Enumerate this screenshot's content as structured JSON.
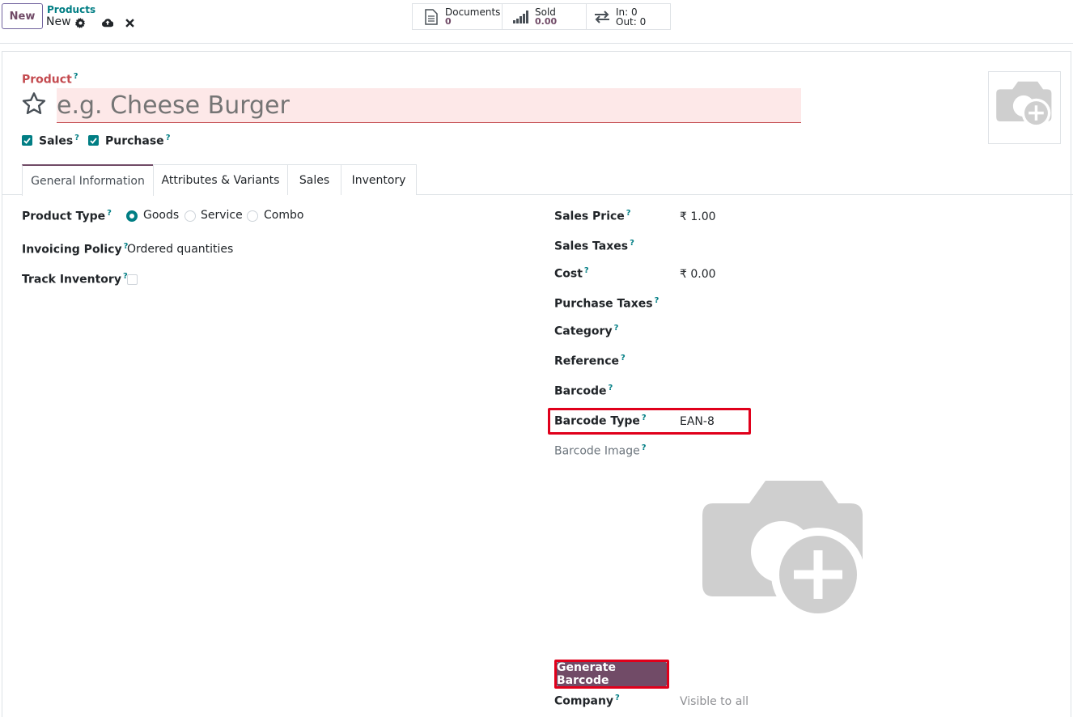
{
  "topbar": {
    "new_label": "New",
    "breadcrumb_parent": "Products",
    "breadcrumb_current": "New",
    "stats": {
      "documents_label": "Documents",
      "documents_value": "0",
      "sold_label": "Sold",
      "sold_value": "0.00",
      "in_label": "In: 0",
      "out_label": "Out: 0"
    }
  },
  "header": {
    "product_label": "Product",
    "name_placeholder": "e.g. Cheese Burger",
    "sales_label": "Sales",
    "purchase_label": "Purchase",
    "help_mark": "?"
  },
  "tabs": [
    {
      "label": "General Information"
    },
    {
      "label": "Attributes & Variants"
    },
    {
      "label": "Sales"
    },
    {
      "label": "Inventory"
    }
  ],
  "left": {
    "product_type_label": "Product Type",
    "type_options": [
      "Goods",
      "Service",
      "Combo"
    ],
    "invoicing_label": "Invoicing Policy",
    "invoicing_value": "Ordered quantities",
    "track_label": "Track Inventory"
  },
  "right": {
    "sales_price_label": "Sales Price",
    "sales_price_value": "₹ 1.00",
    "sales_taxes_label": "Sales Taxes",
    "cost_label": "Cost",
    "cost_value": "₹ 0.00",
    "purchase_taxes_label": "Purchase Taxes",
    "category_label": "Category",
    "reference_label": "Reference",
    "barcode_label": "Barcode",
    "barcode_type_label": "Barcode Type",
    "barcode_type_value": "EAN-8",
    "barcode_image_label": "Barcode Image",
    "generate_button": "Generate Barcode",
    "company_label": "Company",
    "company_value": "Visible to all"
  },
  "colors": {
    "brand": "#714b67",
    "teal": "#017e84",
    "highlight_red": "#e0001b",
    "required_bg": "#fde8e8"
  }
}
